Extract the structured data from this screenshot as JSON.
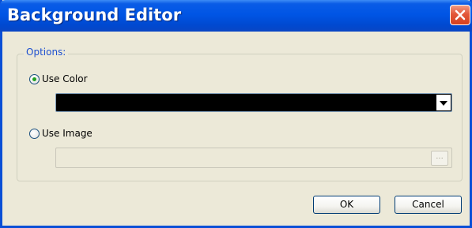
{
  "window": {
    "title": "Background Editor"
  },
  "options": {
    "group_label": "Options:",
    "use_color_label": "Use Color",
    "use_color_selected": true,
    "selected_color": "#000000",
    "use_image_label": "Use Image",
    "use_image_selected": false,
    "image_path_value": "",
    "browse_label": "..."
  },
  "buttons": {
    "ok_label": "OK",
    "cancel_label": "Cancel"
  },
  "colors": {
    "titlebar": "#0055e5",
    "window_background": "#ece9d8",
    "group_label": "#1c4fd0",
    "close_button": "#e3583a"
  },
  "icons": {
    "close": "close-icon",
    "dropdown": "chevron-down-icon"
  }
}
